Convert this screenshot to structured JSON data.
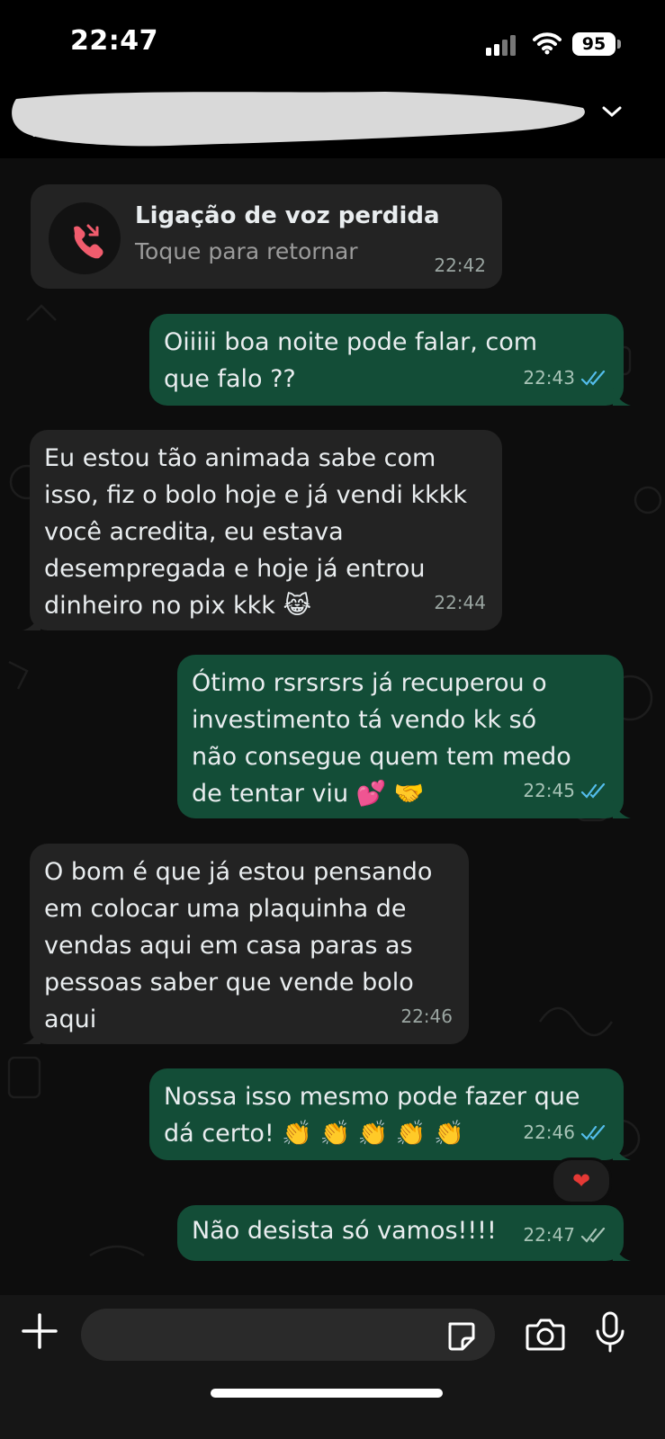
{
  "status": {
    "time": "22:47",
    "battery": "95"
  },
  "call": {
    "title": "Ligação de voz perdida",
    "subtitle": "Toque para retornar",
    "time": "22:42"
  },
  "messages": [
    {
      "text": "Oiiiii boa noite pode falar, com que falo ??",
      "time": "22:43"
    },
    {
      "text": "Eu estou tão animada sabe com isso, fiz o bolo hoje e já vendi kkkk você acredita, eu estava desempregada e hoje já entrou dinheiro no pix kkk 😹",
      "time": "22:44"
    },
    {
      "text": "Ótimo rsrsrsrs já recuperou o investimento tá vendo kk só não consegue quem tem medo de tentar viu 💕 🤝",
      "time": "22:45"
    },
    {
      "text": "O bom é que já estou pensando em colocar uma plaquinha de vendas aqui em casa paras as pessoas saber que vende bolo aqui",
      "time": "22:46"
    },
    {
      "text": "Nossa isso mesmo pode fazer que dá certo! 👏 👏 👏 👏 👏",
      "time": "22:46"
    },
    {
      "text": "Não desista só vamos!!!!",
      "time": "22:47"
    }
  ],
  "reaction": "❤",
  "colors": {
    "outgoing": "#134d37",
    "incoming": "#232323",
    "read_tick": "#53bdeb",
    "missed_call": "#f15c6d"
  }
}
